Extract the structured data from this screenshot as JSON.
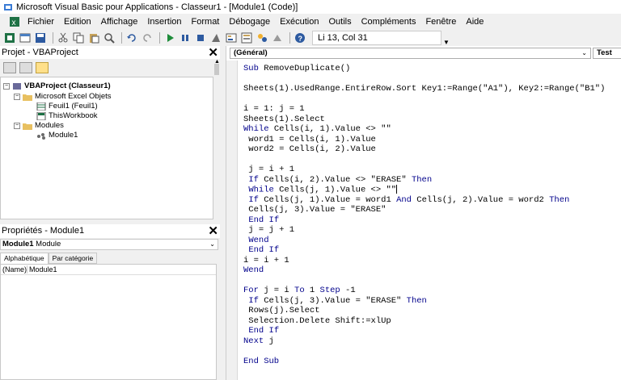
{
  "window": {
    "title": "Microsoft Visual Basic pour Applications - Classeur1 - [Module1 (Code)]"
  },
  "menu": {
    "items": [
      "Fichier",
      "Edition",
      "Affichage",
      "Insertion",
      "Format",
      "Débogage",
      "Exécution",
      "Outils",
      "Compléments",
      "Fenêtre",
      "Aide"
    ]
  },
  "toolbar": {
    "position_text": "Li 13, Col 31"
  },
  "project_panel": {
    "title": "Projet - VBAProject",
    "tree": {
      "project": "VBAProject (Classeur1)",
      "excel_objects_folder": "Microsoft Excel Objets",
      "sheet1": "Feuil1 (Feuil1)",
      "workbook": "ThisWorkbook",
      "modules_folder": "Modules",
      "module1": "Module1"
    }
  },
  "properties_panel": {
    "title": "Propriétés - Module1",
    "object_name": "Module1",
    "object_type": "Module",
    "tabs": [
      "Alphabétique",
      "Par catégorie"
    ],
    "rows": [
      {
        "name": "(Name)",
        "value": "Module1"
      }
    ]
  },
  "code_window": {
    "object_combo": "(Général)",
    "proc_combo": "Test",
    "lines": [
      "Sub RemoveDuplicate()",
      "",
      "Sheets(1).UsedRange.EntireRow.Sort Key1:=Range(\"A1\"), Key2:=Range(\"B1\")",
      "",
      "i = 1: j = 1",
      "Sheets(1).Select",
      "While Cells(i, 1).Value <> \"\"",
      " word1 = Cells(i, 1).Value",
      " word2 = Cells(i, 2).Value",
      "",
      " j = i + 1",
      " If Cells(i, 2).Value <> \"ERASE\" Then",
      " While Cells(j, 1).Value <> \"\"",
      " If Cells(j, 1).Value = word1 And Cells(j, 2).Value = word2 Then",
      " Cells(j, 3).Value = \"ERASE\"",
      " End If",
      " j = j + 1",
      " Wend",
      " End If",
      "i = i + 1",
      "Wend",
      "",
      "For j = i To 1 Step -1",
      " If Cells(j, 3).Value = \"ERASE\" Then",
      " Rows(j).Select",
      " Selection.Delete Shift:=xlUp",
      " End If",
      "Next j",
      "",
      "End Sub"
    ]
  }
}
